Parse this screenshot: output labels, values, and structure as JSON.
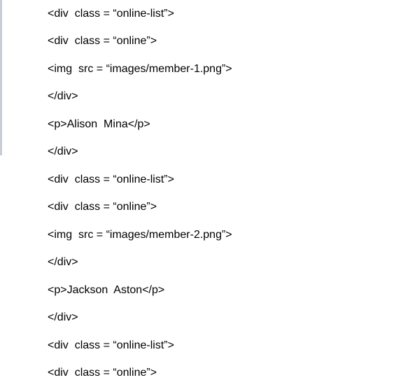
{
  "document": {
    "lines": [
      "<div  class = “online-list”>",
      "<div  class = “online”>",
      "<img  src = “images/member-1.png”>",
      "</div>",
      "<p>Alison  Mina</p>",
      "</div>",
      "<div  class = “online-list”>",
      "<div  class = “online”>",
      "<img  src = “images/member-2.png”>",
      "</div>",
      "<p>Jackson  Aston</p>",
      "</div>",
      "<div  class = “online-list”>",
      "<div  class = “online”>"
    ]
  }
}
